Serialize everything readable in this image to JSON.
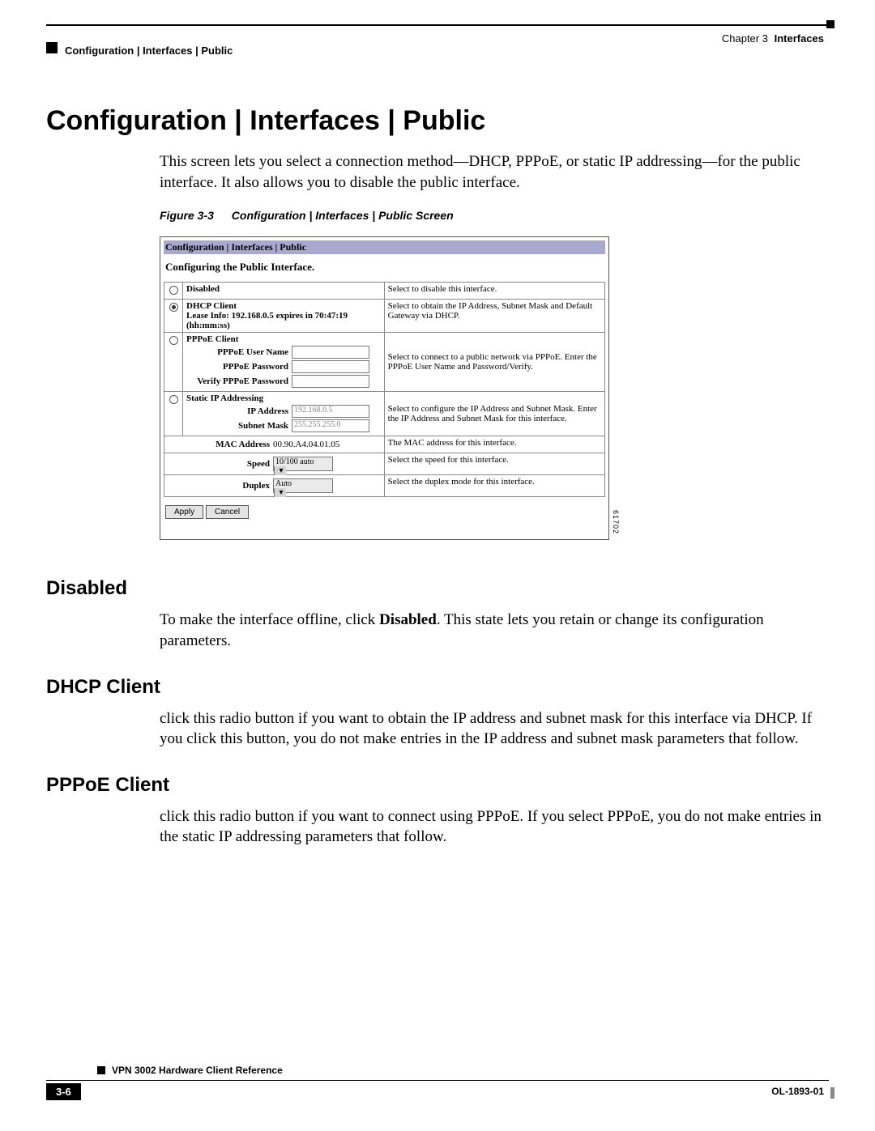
{
  "header": {
    "chapter_prefix": "Chapter 3",
    "chapter_title": "Interfaces",
    "breadcrumb": "Configuration | Interfaces | Public"
  },
  "title": "Configuration | Interfaces | Public",
  "intro": "This screen lets you select a connection method—DHCP, PPPoE, or static IP addressing—for the public interface. It also allows you to disable the public interface.",
  "figure": {
    "label": "Figure 3-3",
    "caption": "Configuration | Interfaces | Public Screen"
  },
  "screenshot": {
    "titlebar": "Configuration | Interfaces | Public",
    "subtitle": "Configuring the Public Interface.",
    "rows": {
      "disabled": {
        "label": "Disabled",
        "desc": "Select to disable this interface."
      },
      "dhcp": {
        "label": "DHCP Client",
        "lease": "Lease Info: 192.168.0.5 expires in 70:47:19 (hh:mm:ss)",
        "desc": "Select to obtain the IP Address, Subnet Mask and Default Gateway via DHCP."
      },
      "pppoe": {
        "label": "PPPoE Client",
        "user_label": "PPPoE User Name",
        "pass_label": "PPPoE Password",
        "verify_label": "Verify PPPoE Password",
        "desc": "Select to connect to a public network via PPPoE. Enter the PPPoE User Name and Password/Verify."
      },
      "static": {
        "label": "Static IP Addressing",
        "ip_label": "IP Address",
        "ip_value": "192.168.0.5",
        "mask_label": "Subnet Mask",
        "mask_value": "255.255.255.0",
        "desc": "Select to configure the IP Address and Subnet Mask. Enter the IP Address and Subnet Mask for this interface."
      },
      "mac": {
        "label": "MAC Address",
        "value": "00.90.A4.04.01.05",
        "desc": "The MAC address for this interface."
      },
      "speed": {
        "label": "Speed",
        "value": "10/100 auto",
        "desc": "Select the speed for this interface."
      },
      "duplex": {
        "label": "Duplex",
        "value": "Auto",
        "desc": "Select the duplex mode for this interface."
      }
    },
    "buttons": {
      "apply": "Apply",
      "cancel": "Cancel"
    },
    "id": "61702"
  },
  "sections": {
    "disabled": {
      "heading": "Disabled",
      "text_before": "To make the interface offline, click ",
      "bold": "Disabled",
      "text_after": ". This state lets you retain or change its configuration parameters."
    },
    "dhcp": {
      "heading": "DHCP Client",
      "text": "click this radio button if you want to obtain the IP address and subnet mask for this interface via DHCP. If you click this button, you do not make entries in the IP address and subnet mask parameters that follow."
    },
    "pppoe": {
      "heading": "PPPoE Client",
      "text": "click this radio button if you want to connect using PPPoE. If you select PPPoE, you do not make entries in the static IP addressing parameters that follow."
    }
  },
  "footer": {
    "book": "VPN 3002 Hardware Client Reference",
    "page": "3-6",
    "docid": "OL-1893-01"
  }
}
